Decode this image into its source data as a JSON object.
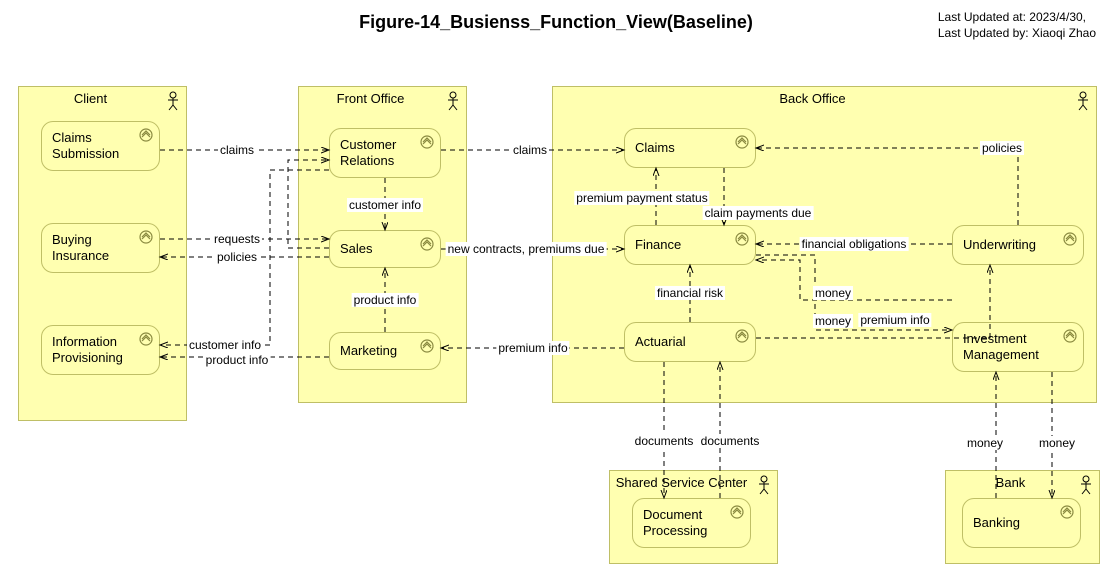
{
  "title": "Figure-14_Busienss_Function_View(Baseline)",
  "meta": {
    "updated_at_label": "Last Updated at:",
    "updated_at": "2023/4/30,",
    "updated_by_label": "Last Updated by:",
    "updated_by": "Xiaoqi Zhao"
  },
  "actors": {
    "client": {
      "title": "Client"
    },
    "front_office": {
      "title": "Front Office"
    },
    "back_office": {
      "title": "Back Office"
    },
    "shared_service_center": {
      "title": "Shared Service Center"
    },
    "bank": {
      "title": "Bank"
    }
  },
  "functions": {
    "claims_submission": {
      "label": "Claims\nSubmission"
    },
    "buying_insurance": {
      "label": "Buying\nInsurance"
    },
    "information_provisioning": {
      "label": "Information\nProvisioning"
    },
    "customer_relations": {
      "label": "Customer\nRelations"
    },
    "sales": {
      "label": "Sales"
    },
    "marketing": {
      "label": "Marketing"
    },
    "claims": {
      "label": "Claims"
    },
    "finance": {
      "label": "Finance"
    },
    "underwriting": {
      "label": "Underwriting"
    },
    "actuarial": {
      "label": "Actuarial"
    },
    "investment_management": {
      "label": "Investment\nManagement"
    },
    "document_processing": {
      "label": "Document\nProcessing"
    },
    "banking": {
      "label": "Banking"
    }
  },
  "edges": {
    "claims1": {
      "label": "claims"
    },
    "claims2": {
      "label": "claims"
    },
    "customer_info1": {
      "label": "customer info"
    },
    "requests": {
      "label": "requests"
    },
    "policies1": {
      "label": "policies"
    },
    "customer_info2": {
      "label": "customer info"
    },
    "product_info1": {
      "label": "product info"
    },
    "product_info2": {
      "label": "product info"
    },
    "new_contracts": {
      "label": "new contracts, premiums due"
    },
    "premium_info_mkt": {
      "label": "premium info"
    },
    "premium_payment_status": {
      "label": "premium payment status"
    },
    "claim_payments_due": {
      "label": "claim payments due"
    },
    "financial_obligations": {
      "label": "financial obligations"
    },
    "financial_risk": {
      "label": "financial risk"
    },
    "money1": {
      "label": "money"
    },
    "money2": {
      "label": "money"
    },
    "premium_info_uw": {
      "label": "premium info"
    },
    "policies2": {
      "label": "policies"
    },
    "documents1": {
      "label": "documents"
    },
    "documents2": {
      "label": "documents"
    },
    "money_bank_in": {
      "label": "money"
    },
    "money_bank_out": {
      "label": "money"
    }
  },
  "icons": {
    "actor_icon": "actor-icon",
    "chevron_up_icon": "chevron-up-icon"
  }
}
